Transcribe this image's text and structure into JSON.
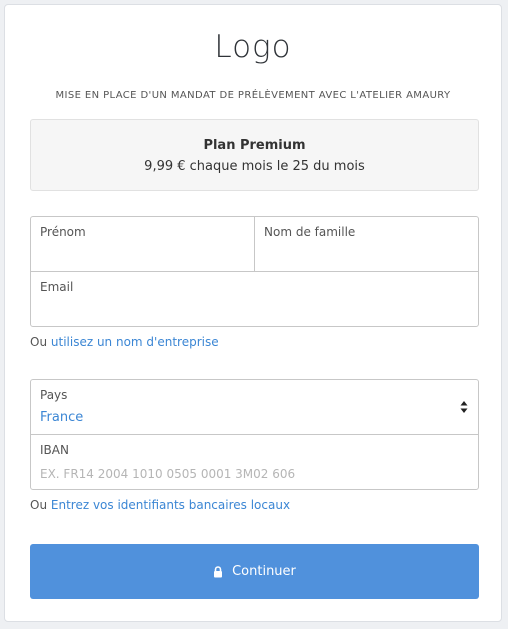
{
  "header": {
    "logo": "Logo",
    "subtitle": "MISE EN PLACE D'UN MANDAT DE PRÉLÈVEMENT AVEC L'ATELIER AMAURY"
  },
  "plan": {
    "name": "Plan Premium",
    "price": "9,99 € chaque mois le 25 du mois"
  },
  "form": {
    "first_name_label": "Prénom",
    "first_name_value": "",
    "last_name_label": "Nom de famille",
    "last_name_value": "",
    "email_label": "Email",
    "email_value": "",
    "company_prefix": "Ou",
    "company_link": "utilisez un nom d'entreprise",
    "country_label": "Pays",
    "country_value": "France",
    "iban_label": "IBAN",
    "iban_placeholder": "EX. FR14 2004 1010 0505 0001 3M02 606",
    "bank_prefix": "Ou",
    "bank_link": "Entrez vos identifiants bancaires locaux"
  },
  "submit": {
    "label": "Continuer",
    "icon": "lock-icon",
    "color": "#5091dc"
  },
  "colors": {
    "link": "#3b86d4",
    "button": "#5091dc"
  }
}
